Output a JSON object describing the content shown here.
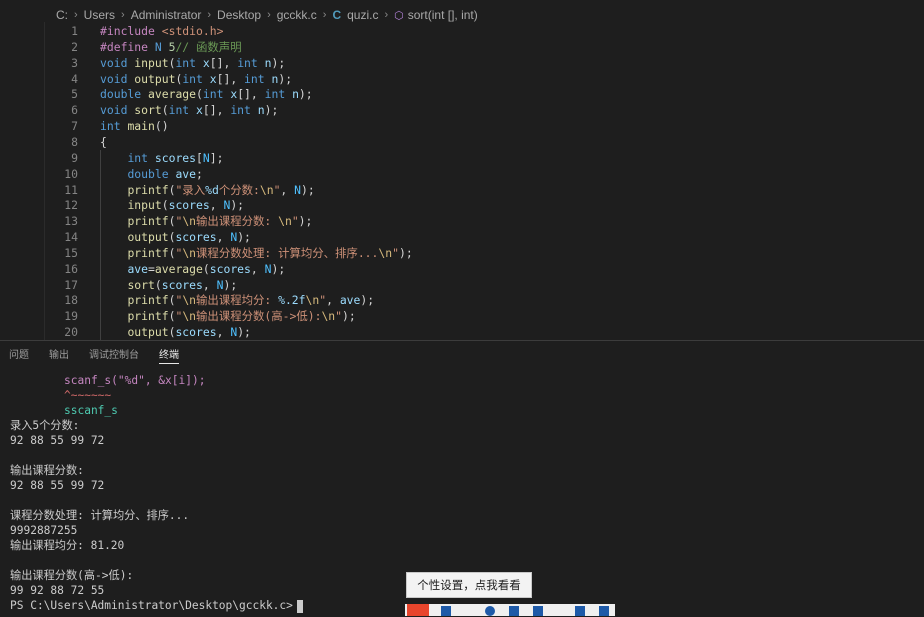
{
  "breadcrumb": [
    "C:",
    "Users",
    "Administrator",
    "Desktop",
    "gcckk.c",
    "quzi.c",
    "sort(int [], int)"
  ],
  "code_lines": [
    {
      "n": "1",
      "html": "<span class=\"p\">#include</span> <span class=\"s\">&lt;stdio.h&gt;</span>"
    },
    {
      "n": "2",
      "html": "<span class=\"p\">#define</span> <span class=\"k\">N</span> <span class=\"n\">5</span><span class=\"cm\">// 函数声明</span>"
    },
    {
      "n": "3",
      "html": "<span class=\"k\">void</span> <span class=\"f\">input</span>(<span class=\"k\">int</span> <span class=\"v\">x</span>[], <span class=\"k\">int</span> <span class=\"v\">n</span>);"
    },
    {
      "n": "4",
      "html": "<span class=\"k\">void</span> <span class=\"f\">output</span>(<span class=\"k\">int</span> <span class=\"v\">x</span>[], <span class=\"k\">int</span> <span class=\"v\">n</span>);"
    },
    {
      "n": "5",
      "html": "<span class=\"k\">double</span> <span class=\"f\">average</span>(<span class=\"k\">int</span> <span class=\"v\">x</span>[], <span class=\"k\">int</span> <span class=\"v\">n</span>);"
    },
    {
      "n": "6",
      "html": "<span class=\"k\">void</span> <span class=\"f\">sort</span>(<span class=\"k\">int</span> <span class=\"v\">x</span>[], <span class=\"k\">int</span> <span class=\"v\">n</span>);"
    },
    {
      "n": "7",
      "html": "<span class=\"k\">int</span> <span class=\"f\">main</span>()"
    },
    {
      "n": "8",
      "html": "{"
    },
    {
      "n": "9",
      "html": "    <span class=\"k\">int</span> <span class=\"v\">scores</span>[<span class=\"m\">N</span>];"
    },
    {
      "n": "10",
      "html": "    <span class=\"k\">double</span> <span class=\"v\">ave</span>;"
    },
    {
      "n": "11",
      "html": "    <span class=\"f\">printf</span>(<span class=\"s\">\"录入</span><span class=\"v\">%d</span><span class=\"s\">个分数:</span><span class=\"e\">\\n</span><span class=\"s\">\"</span>, <span class=\"m\">N</span>);"
    },
    {
      "n": "12",
      "html": "    <span class=\"f\">input</span>(<span class=\"v\">scores</span>, <span class=\"m\">N</span>);"
    },
    {
      "n": "13",
      "html": "    <span class=\"f\">printf</span>(<span class=\"s\">\"</span><span class=\"e\">\\n</span><span class=\"s\">输出课程分数: </span><span class=\"e\">\\n</span><span class=\"s\">\"</span>);"
    },
    {
      "n": "14",
      "html": "    <span class=\"f\">output</span>(<span class=\"v\">scores</span>, <span class=\"m\">N</span>);"
    },
    {
      "n": "15",
      "html": "    <span class=\"f\">printf</span>(<span class=\"s\">\"</span><span class=\"e\">\\n</span><span class=\"s\">课程分数处理: 计算均分、排序...</span><span class=\"e\">\\n</span><span class=\"s\">\"</span>);"
    },
    {
      "n": "16",
      "html": "    <span class=\"v\">ave</span>=<span class=\"f\">average</span>(<span class=\"v\">scores</span>, <span class=\"m\">N</span>);"
    },
    {
      "n": "17",
      "html": "    <span class=\"f\">sort</span>(<span class=\"v\">scores</span>, <span class=\"m\">N</span>);"
    },
    {
      "n": "18",
      "html": "    <span class=\"f\">printf</span>(<span class=\"s\">\"</span><span class=\"e\">\\n</span><span class=\"s\">输出课程均分: </span><span class=\"v\">%.2f</span><span class=\"e\">\\n</span><span class=\"s\">\"</span>, <span class=\"v\">ave</span>);"
    },
    {
      "n": "19",
      "html": "    <span class=\"f\">printf</span>(<span class=\"s\">\"</span><span class=\"e\">\\n</span><span class=\"s\">输出课程分数(高-&gt;低):</span><span class=\"e\">\\n</span><span class=\"s\">\"</span>);"
    },
    {
      "n": "20",
      "html": "    <span class=\"f\">output</span>(<span class=\"v\">scores</span>, <span class=\"m\">N</span>);"
    }
  ],
  "panel": {
    "tabs": [
      "问题",
      "输出",
      "调试控制台",
      "终端"
    ],
    "active_tab": 3,
    "terminal": {
      "warn_code": "scanf_s(\"%d\", &x[i]);",
      "warn_squiggle": "^~~~~~~",
      "warn_hint": "sscanf_s",
      "output": [
        "录入5个分数:",
        "92 88 55 99 72",
        "",
        "输出课程分数:",
        "92 88 55 99 72",
        "",
        "课程分数处理: 计算均分、排序...",
        "9992887255",
        "输出课程均分: 81.20",
        "",
        "输出课程分数(高->低):",
        "99 92 88 72 55"
      ],
      "prompt": "PS C:\\Users\\Administrator\\Desktop\\gcckk.c>"
    }
  },
  "tooltip": "个性设置，点我看看",
  "icons": {
    "file_c": "c-file-icon",
    "symbol": "method-cube-icon",
    "ime": "sogou-ime-icon"
  }
}
